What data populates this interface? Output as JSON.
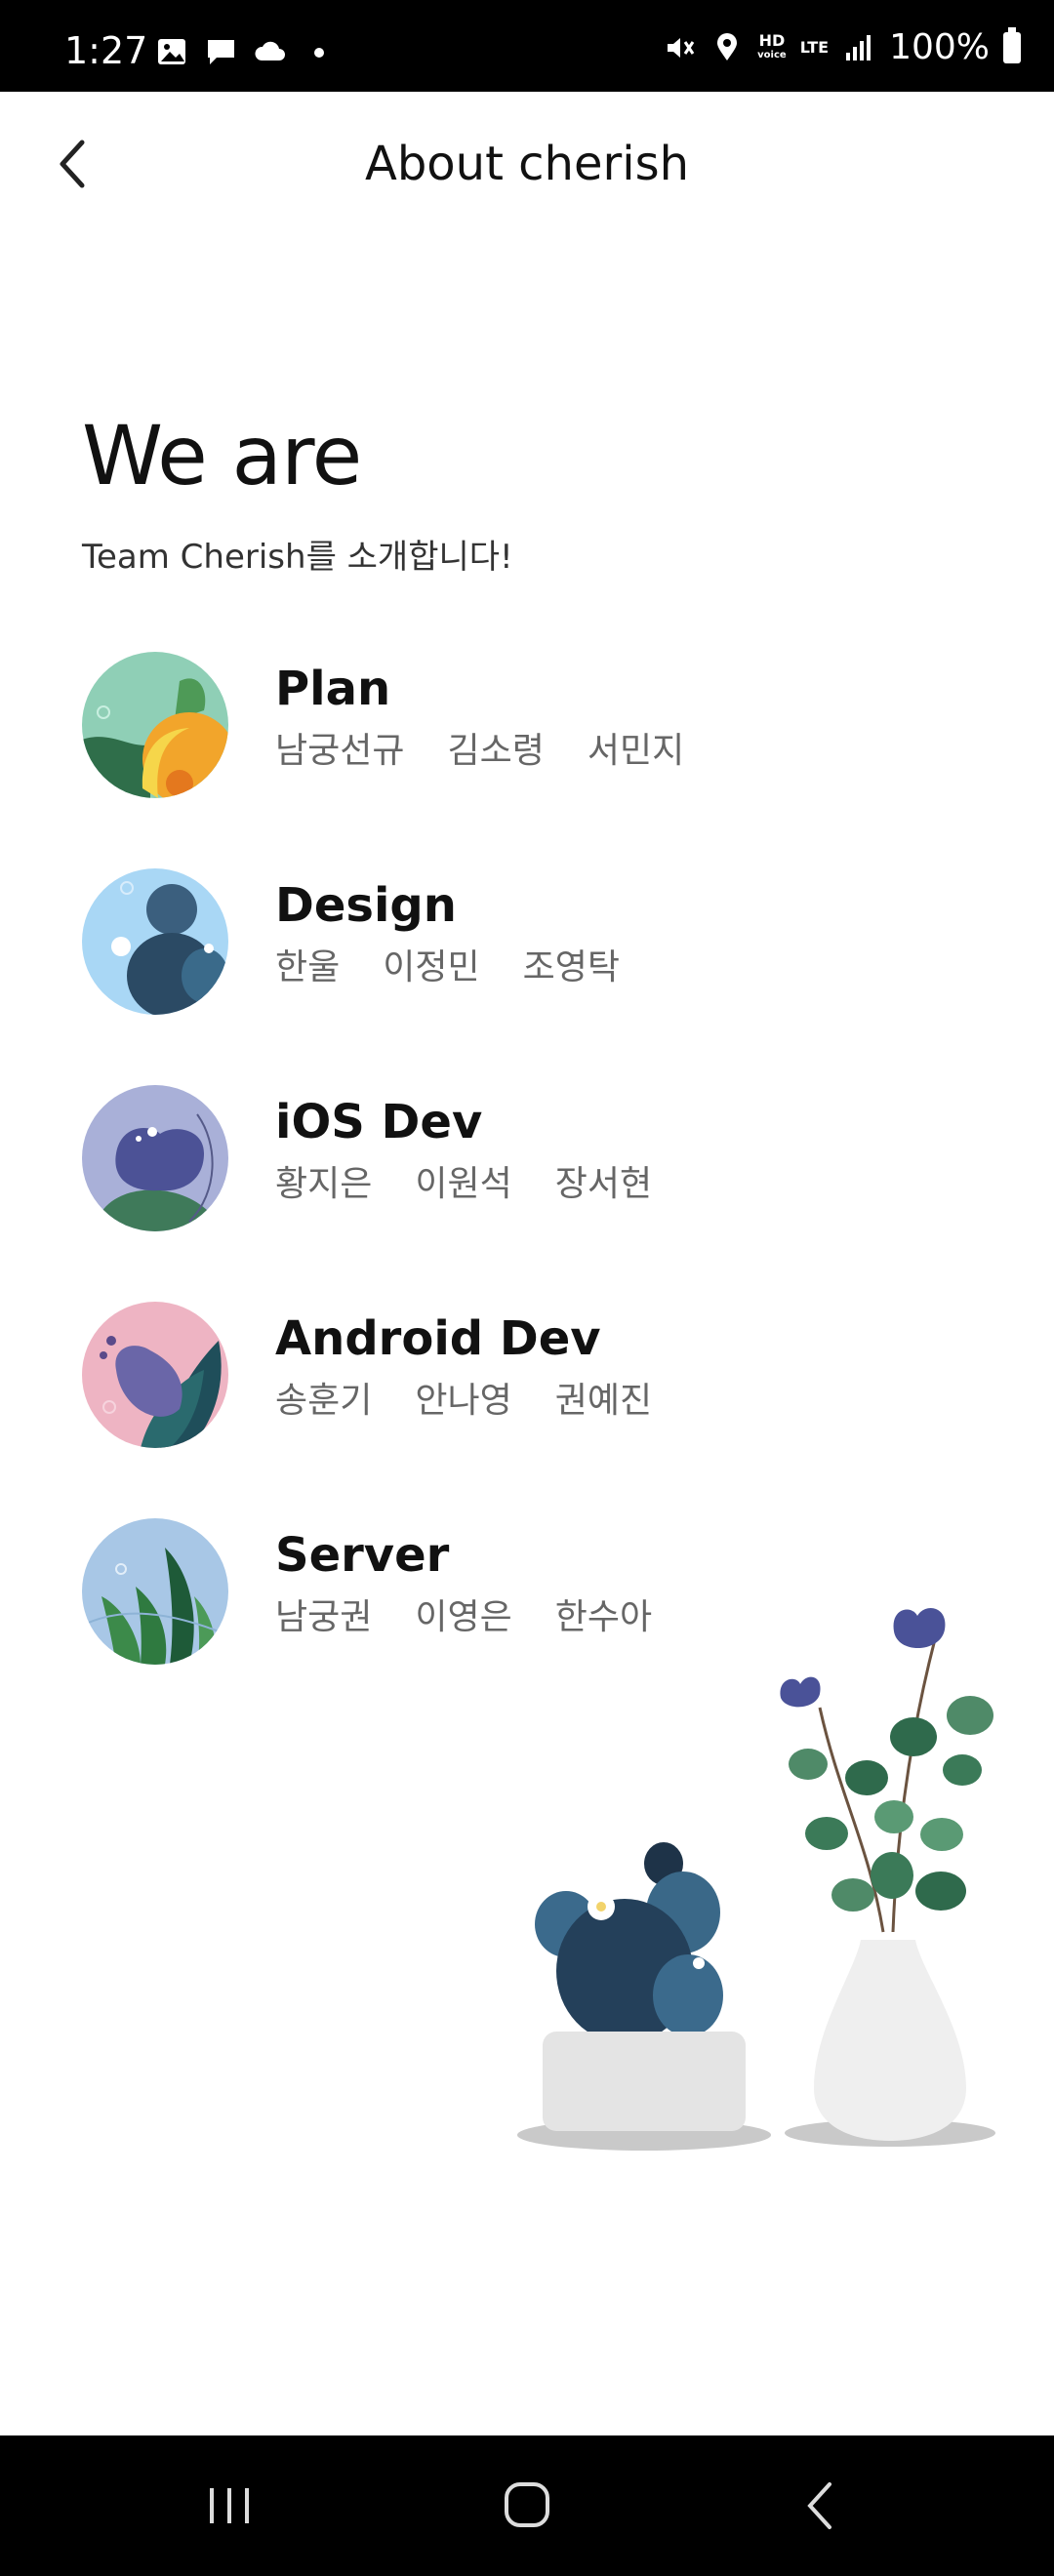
{
  "status_bar": {
    "time": "1:27",
    "battery": "100%",
    "hd_label": "HD",
    "voice_label": "voice",
    "lte_label": "LTE"
  },
  "header": {
    "title": "About cherish"
  },
  "hero": {
    "title": "We are",
    "subtitle": "Team Cherish를 소개합니다!"
  },
  "teams": [
    {
      "name": "Plan",
      "members": [
        "남궁선규",
        "김소령",
        "서민지"
      ],
      "avatar_bg": "#8fcfb6"
    },
    {
      "name": "Design",
      "members": [
        "한울",
        "이정민",
        "조영탁"
      ],
      "avatar_bg": "#a9d7f5"
    },
    {
      "name": "iOS Dev",
      "members": [
        "황지은",
        "이원석",
        "장서현"
      ],
      "avatar_bg": "#a9b0d8"
    },
    {
      "name": "Android Dev",
      "members": [
        "송훈기",
        "안나영",
        "권예진"
      ],
      "avatar_bg": "#eeb4c3"
    },
    {
      "name": "Server",
      "members": [
        "남궁권",
        "이영은",
        "한수아"
      ],
      "avatar_bg": "#a8c7e6"
    }
  ],
  "colors": {
    "status_bar": "#000000",
    "nav_bar": "#000000",
    "text_primary": "#111111",
    "text_secondary": "#666666"
  },
  "icons": {
    "back": "chevron-left-icon",
    "nav_recent": "recent-apps-icon",
    "nav_home": "home-icon",
    "nav_back": "nav-back-icon"
  }
}
